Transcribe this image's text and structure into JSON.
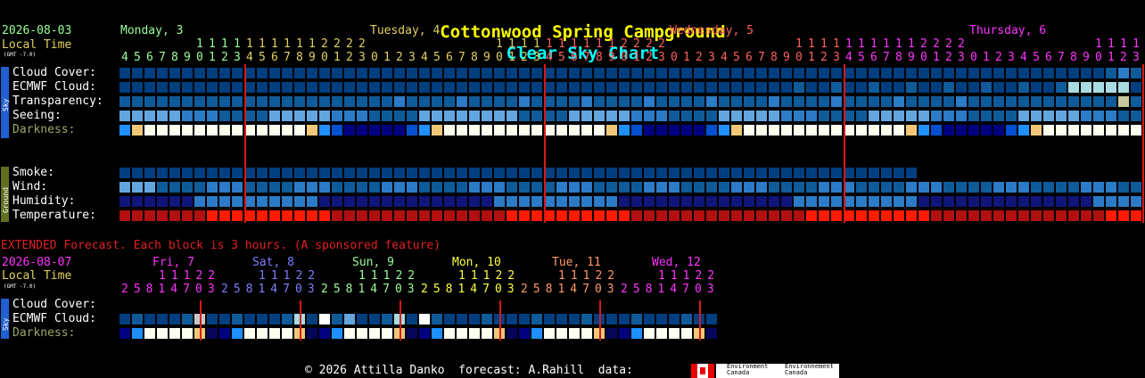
{
  "title": {
    "site": "Cottonwood Spring Campground",
    "chart": "Clear Sky Chart"
  },
  "colors": {
    "title_site": "#ffff00",
    "title_chart": "#00ffff",
    "green": "#9aff9a",
    "yellow": "#e0d060",
    "red": "#ff6060",
    "orange": "#ff9966",
    "magenta": "#ff33ff",
    "blue_label": "#5f9fff",
    "grid_line": "#d81818"
  },
  "header": {
    "date": "2026-08-03",
    "local_time": "Local Time",
    "gmt": "(GMT -7.0)"
  },
  "days": [
    {
      "label": "Monday, 3",
      "color": "#9aff9a"
    },
    {
      "label": "Tuesday, 4",
      "color": "#e0d060"
    },
    {
      "label": "Wednesday, 5",
      "color": "#ff6060"
    },
    {
      "label": "Thursday, 6",
      "color": "#ff33ff"
    }
  ],
  "hours_tens": "11111112222      1111111111112222        11111111111112222        11111111111112222",
  "hours_ones": "4567890123012345678901234567890123012345678901234567890123012345678901234567890123",
  "sky_section": {
    "tag": "Sky",
    "rows": [
      {
        "label": "Cloud Cover:"
      },
      {
        "label": "ECMWF Cloud:"
      },
      {
        "label": "Transparency:"
      },
      {
        "label": "Seeing:"
      },
      {
        "label": "Darkness:"
      }
    ]
  },
  "ground_section": {
    "tag": "Ground",
    "rows": [
      {
        "label": "Smoke:"
      },
      {
        "label": "Wind:"
      },
      {
        "label": "Humidity:"
      },
      {
        "label": "Temperature:"
      }
    ]
  },
  "extended": {
    "banner": "EXTENDED Forecast. Each block is 3 hours. (A sponsored feature)",
    "date": "2026-08-07",
    "local_time": "Local Time",
    "gmt": "(GMT -7.0)",
    "days": [
      {
        "label": "Fri, 7",
        "color": "#ff33ff"
      },
      {
        "label": "Sat, 8",
        "color": "#7f7fff"
      },
      {
        "label": "Sun, 9",
        "color": "#9aff9a"
      },
      {
        "label": "Mon, 10",
        "color": "#ffff40"
      },
      {
        "label": "Tue, 11",
        "color": "#ff9966"
      },
      {
        "label": "Wed, 12",
        "color": "#ff33ff"
      }
    ],
    "tens": "11122",
    "ones": "25814703",
    "rows": [
      {
        "label": "Cloud Cover:"
      },
      {
        "label": "ECMWF Cloud:"
      },
      {
        "label": "Darkness:"
      }
    ]
  },
  "footer": {
    "text": "© 2026 Attilla Danko  forecast: A.Rahill  data:",
    "logo_text_1": "Environment Canada",
    "logo_text_2": "Environnement Canada"
  }
}
